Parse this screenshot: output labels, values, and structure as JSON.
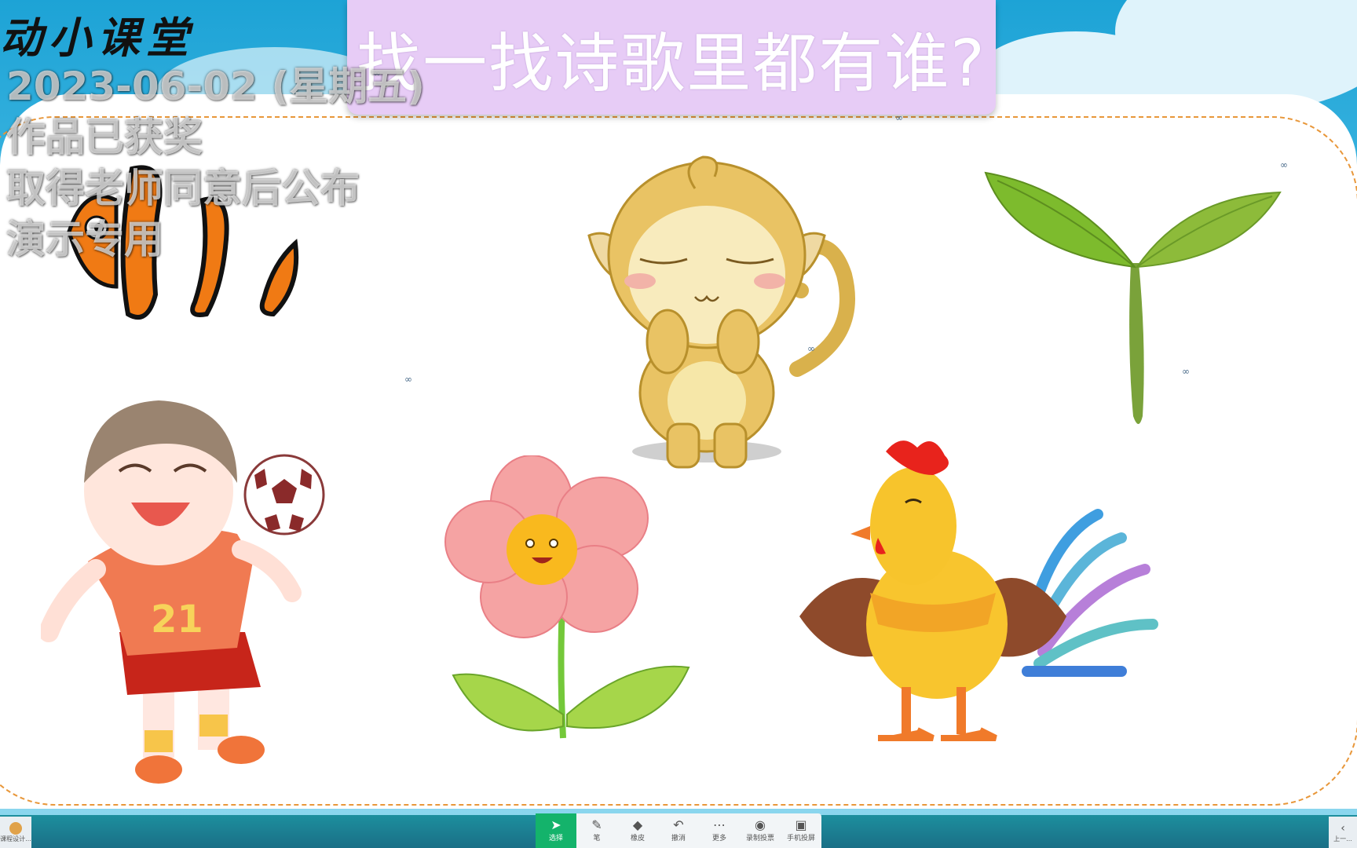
{
  "header": {
    "brand": "动小课堂",
    "title": "找一找诗歌里都有谁?"
  },
  "watermark": {
    "date": "2023-06-02 (星期五)",
    "line1": "作品已获奖",
    "line2": "取得老师同意后公布",
    "line3": "演示专用"
  },
  "canvas": {
    "images": [
      {
        "name": "clownfish",
        "label": "clownfish"
      },
      {
        "name": "monkey",
        "label": "monkey"
      },
      {
        "name": "sprout",
        "label": "sprout"
      },
      {
        "name": "soccer-boy",
        "label": "boy with soccer ball",
        "jersey_number": "21"
      },
      {
        "name": "flower",
        "label": "flower"
      },
      {
        "name": "rooster",
        "label": "rooster"
      }
    ]
  },
  "toolbar": {
    "tools": [
      {
        "icon": "cursor-icon",
        "label": "选择",
        "active": true
      },
      {
        "icon": "pen-icon",
        "label": "笔",
        "active": false
      },
      {
        "icon": "eraser-icon",
        "label": "橡皮",
        "active": false
      },
      {
        "icon": "undo-icon",
        "label": "撤消",
        "active": false
      },
      {
        "icon": "more-icon",
        "label": "更多",
        "active": false
      },
      {
        "icon": "record-icon",
        "label": "录制投票",
        "active": false
      },
      {
        "icon": "phone-cast-icon",
        "label": "手机投屏",
        "active": false
      }
    ],
    "left_label": "课程设计...",
    "right_label": "上一..."
  },
  "colors": {
    "title_bg": "#e7ccf6",
    "board_border": "#e8973a",
    "toolbar_active": "#14b36b",
    "sky": "#1da3d6"
  }
}
